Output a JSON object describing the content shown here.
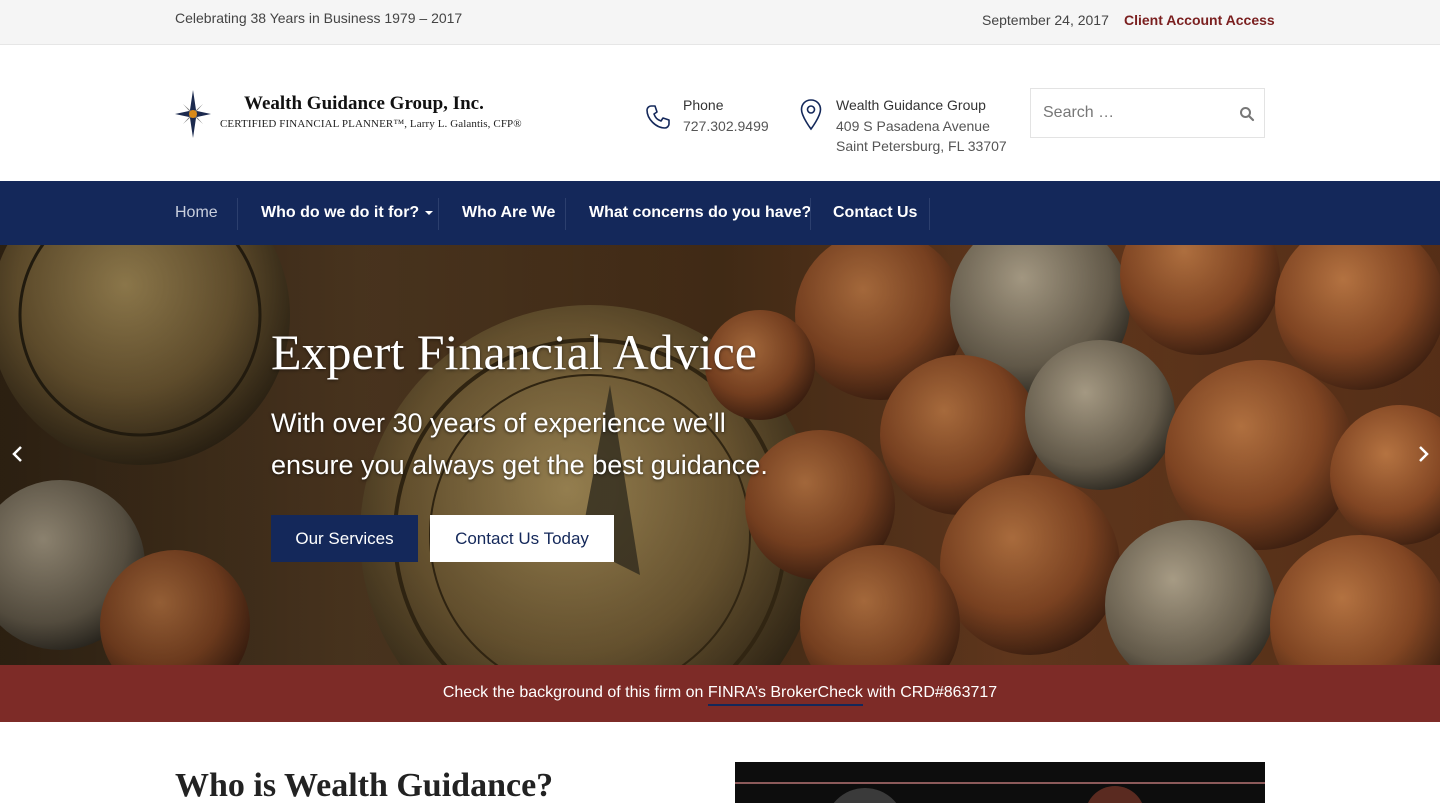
{
  "topbar": {
    "tagline": "Celebrating 38 Years in Business 1979 – 2017",
    "date": "September 24, 2017",
    "client_access": "Client Account Access"
  },
  "header": {
    "logo": {
      "name": "Wealth Guidance Group, Inc.",
      "subtitle": "CERTIFIED FINANCIAL PLANNER™, Larry L. Galantis, CFP®"
    },
    "phone": {
      "label": "Phone",
      "value": "727.302.9499"
    },
    "address": {
      "label": "Wealth Guidance Group",
      "line1": "409 S Pasadena Avenue",
      "line2": "Saint Petersburg, FL 33707"
    },
    "search": {
      "placeholder": "Search …"
    }
  },
  "nav": {
    "items": [
      {
        "label": "Home",
        "active": true
      },
      {
        "label": "Who do we do it for?",
        "has_dropdown": true
      },
      {
        "label": "Who Are We"
      },
      {
        "label": "What concerns do you have?"
      },
      {
        "label": "Contact Us"
      }
    ]
  },
  "hero": {
    "title": "Expert Financial Advice",
    "lead": "With over 30 years of experience we’ll ensure you always get the best guidance.",
    "primary_button": "Our Services",
    "secondary_button": "Contact Us Today"
  },
  "notice": {
    "prefix": "Check the background of this firm on ",
    "link": "FINRA’s BrokerCheck",
    "suffix": " with CRD#863717"
  },
  "content": {
    "title": "Who is Wealth Guidance?"
  },
  "colors": {
    "navy": "#14285a",
    "maroon": "#7d2b27",
    "client_link": "#7a1f1f"
  },
  "icons": {
    "logo": "compass-star-icon",
    "phone": "phone-icon",
    "address": "map-pin-icon",
    "search": "search-icon",
    "prev": "chevron-left-icon",
    "next": "chevron-right-icon",
    "dropdown": "caret-down-icon"
  }
}
